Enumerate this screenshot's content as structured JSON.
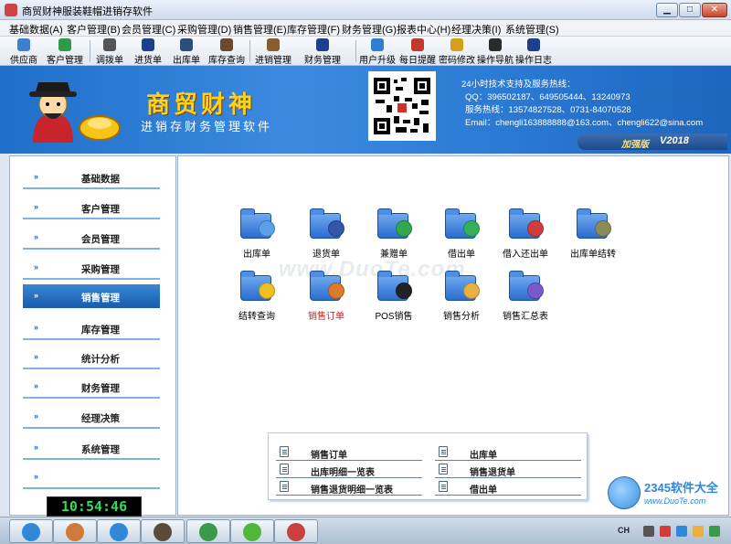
{
  "window": {
    "title": "商贸财神服装鞋帽进销存软件",
    "min_symbol": "▁",
    "max_symbol": "□",
    "close_symbol": "✕"
  },
  "menu": [
    "基础数据(A)",
    "客户管理(B)",
    "会员管理(C)",
    "采购管理(D)",
    "销售管理(E)",
    "库存管理(F)",
    "财务管理(G)",
    "报表中心(H)",
    "经理决策(I)",
    "系统管理(S)"
  ],
  "toolbar": [
    {
      "label": "供应商",
      "icon": "supplier-icon",
      "color": "#3d7fd1"
    },
    {
      "label": "客户管理",
      "icon": "customer-icon",
      "color": "#2f9a47"
    },
    {
      "label": "调拨单",
      "icon": "transfer-icon",
      "color": "#555555"
    },
    {
      "label": "进货单",
      "icon": "purchase-icon",
      "color": "#1c3f8f"
    },
    {
      "label": "出库单",
      "icon": "outbound-icon",
      "color": "#2b4f7a"
    },
    {
      "label": "库存查询",
      "icon": "inventory-icon",
      "color": "#6a4a2c"
    },
    {
      "label": "进销管理",
      "icon": "trade-icon",
      "color": "#8a5b2b"
    },
    {
      "label": "财务管理",
      "icon": "finance-icon",
      "color": "#1c3f8f"
    },
    {
      "label": "用户升级",
      "icon": "upgrade-icon",
      "color": "#2f7fd1"
    },
    {
      "label": "每日提醒",
      "icon": "reminder-icon",
      "color": "#c0392b"
    },
    {
      "label": "密码修改",
      "icon": "password-icon",
      "color": "#d4a017"
    },
    {
      "label": "操作导航",
      "icon": "navigation-icon",
      "color": "#2b2b2b"
    },
    {
      "label": "操作日志",
      "icon": "log-icon",
      "color": "#1c3f8f"
    }
  ],
  "banner": {
    "brand": "商贸财神",
    "subtitle": "进销存财务管理软件",
    "support_title": "24小时技术支持及服务热线：",
    "qq": "QQ：396502187、649505444、13240973",
    "hotline": "服务热线：13574827528、0731-84070528",
    "email": "Email：chengli163888888@163.com、chengli622@sina.com",
    "edition": "加强版",
    "version": "V2018"
  },
  "sidebar": {
    "items": [
      {
        "label": "基础数据",
        "active": false
      },
      {
        "label": "客户管理",
        "active": false
      },
      {
        "label": "会员管理",
        "active": false
      },
      {
        "label": "采购管理",
        "active": false
      },
      {
        "label": "销售管理",
        "active": true
      },
      {
        "label": "库存管理",
        "active": false
      },
      {
        "label": "统计分析",
        "active": false
      },
      {
        "label": "财务管理",
        "active": false
      },
      {
        "label": "经理决策",
        "active": false
      },
      {
        "label": "系统管理",
        "active": false
      },
      {
        "label": "",
        "active": false
      }
    ],
    "arrow": "»",
    "clock": "10:54:46"
  },
  "features": [
    {
      "label": "出库单",
      "icon": "outbound-doc-icon",
      "badge": "#5aa0e8",
      "highlight": false
    },
    {
      "label": "退货单",
      "icon": "return-doc-icon",
      "badge": "#3355aa",
      "highlight": false
    },
    {
      "label": "兼赠单",
      "icon": "gift-doc-icon",
      "badge": "#2fa84f",
      "highlight": false
    },
    {
      "label": "借出单",
      "icon": "lend-doc-icon",
      "badge": "#35b05a",
      "highlight": false
    },
    {
      "label": "借入还出单",
      "icon": "borrow-return-icon",
      "badge": "#d23c3c",
      "highlight": false
    },
    {
      "label": "出库单结转",
      "icon": "carryover-icon",
      "badge": "#8a8a5a",
      "highlight": false
    },
    {
      "label": "结转查询",
      "icon": "carryover-query-icon",
      "badge": "#f0c020",
      "highlight": false
    },
    {
      "label": "销售订单",
      "icon": "sales-order-icon",
      "badge": "#e07a2a",
      "highlight": true
    },
    {
      "label": "POS销售",
      "icon": "pos-icon",
      "badge": "#222222",
      "highlight": false
    },
    {
      "label": "销售分析",
      "icon": "sales-analysis-icon",
      "badge": "#e8b040",
      "highlight": false
    },
    {
      "label": "销售汇总表",
      "icon": "sales-summary-icon",
      "badge": "#7a5acb",
      "highlight": false
    }
  ],
  "watermark": "www.DuoTe.com",
  "quick_links": [
    {
      "label": "销售订单"
    },
    {
      "label": "出库单"
    },
    {
      "label": "出库明细一览表"
    },
    {
      "label": "销售退货单"
    },
    {
      "label": "销售退货明细一览表"
    },
    {
      "label": "借出单"
    }
  ],
  "logo_2345": {
    "title": "2345软件大全",
    "url": "www.DuoTe.com"
  },
  "taskbar": {
    "apps": [
      {
        "icon": "search-app-icon",
        "color": "#2f88d8"
      },
      {
        "icon": "users-app-icon",
        "color": "#d07a3a"
      },
      {
        "icon": "ie-icon",
        "color": "#2f88d8"
      },
      {
        "icon": "eye-app-icon",
        "color": "#5a4a3a"
      },
      {
        "icon": "pen-app-icon",
        "color": "#3a9a4a"
      },
      {
        "icon": "browser-icon",
        "color": "#4fb83a"
      },
      {
        "icon": "cube-app-icon",
        "color": "#c84040"
      }
    ],
    "ime": "CH"
  }
}
